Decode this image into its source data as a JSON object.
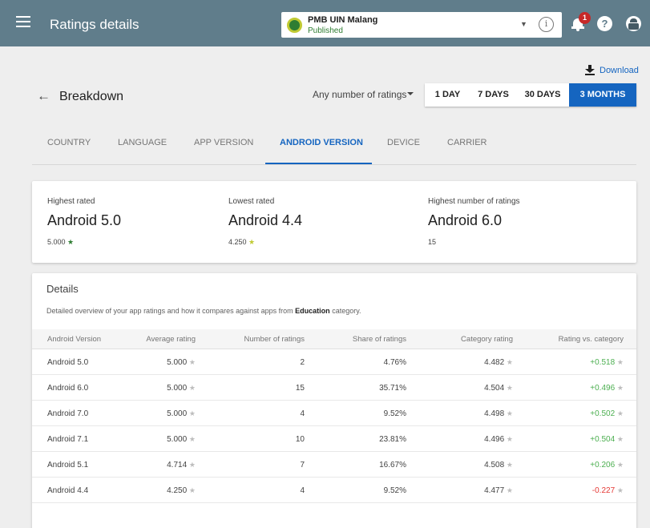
{
  "topbar": {
    "title": "Ratings details",
    "app_name": "PMB UIN Malang",
    "app_status": "Published",
    "notification_count": "1",
    "help_label": "?"
  },
  "download_label": "Download",
  "header": {
    "title": "Breakdown",
    "filter": "Any number of ratings",
    "ranges": [
      "1 DAY",
      "7 DAYS",
      "30 DAYS",
      "3 MONTHS"
    ],
    "active_range": "3 MONTHS"
  },
  "tabs": [
    "COUNTRY",
    "LANGUAGE",
    "APP VERSION",
    "ANDROID VERSION",
    "DEVICE",
    "CARRIER"
  ],
  "active_tab": "ANDROID VERSION",
  "summary": {
    "highest": {
      "label": "Highest rated",
      "value": "Android 5.0",
      "sub": "5.000"
    },
    "lowest": {
      "label": "Lowest rated",
      "value": "Android 4.4",
      "sub": "4.250"
    },
    "most": {
      "label": "Highest number of ratings",
      "value": "Android 6.0",
      "sub": "15"
    }
  },
  "details": {
    "title": "Details",
    "desc_pre": "Detailed overview of your app ratings and how it compares against apps from ",
    "desc_bold": "Education",
    "desc_post": " category.",
    "columns": [
      "Android Version",
      "Average rating",
      "Number of ratings",
      "Share of ratings",
      "Category rating",
      "Rating vs. category"
    ],
    "rows": [
      {
        "version": "Android 5.0",
        "avg": "5.000",
        "num": "2",
        "share": "4.76%",
        "cat": "4.482",
        "vs": "+0.518"
      },
      {
        "version": "Android 6.0",
        "avg": "5.000",
        "num": "15",
        "share": "35.71%",
        "cat": "4.504",
        "vs": "+0.496"
      },
      {
        "version": "Android 7.0",
        "avg": "5.000",
        "num": "4",
        "share": "9.52%",
        "cat": "4.498",
        "vs": "+0.502"
      },
      {
        "version": "Android 7.1",
        "avg": "5.000",
        "num": "10",
        "share": "23.81%",
        "cat": "4.496",
        "vs": "+0.504"
      },
      {
        "version": "Android 5.1",
        "avg": "4.714",
        "num": "7",
        "share": "16.67%",
        "cat": "4.508",
        "vs": "+0.206"
      },
      {
        "version": "Android 4.4",
        "avg": "4.250",
        "num": "4",
        "share": "9.52%",
        "cat": "4.477",
        "vs": "-0.227"
      }
    ]
  },
  "colors": {
    "topbar": "#607d8b",
    "accent": "#1565c0",
    "positive": "#4caf50",
    "negative": "#e53935"
  },
  "icons": [
    "menu-icon",
    "info-icon",
    "bell-icon",
    "help-icon",
    "account-icon",
    "download-icon",
    "back-arrow-icon",
    "star-icon",
    "chevron-down-icon"
  ]
}
